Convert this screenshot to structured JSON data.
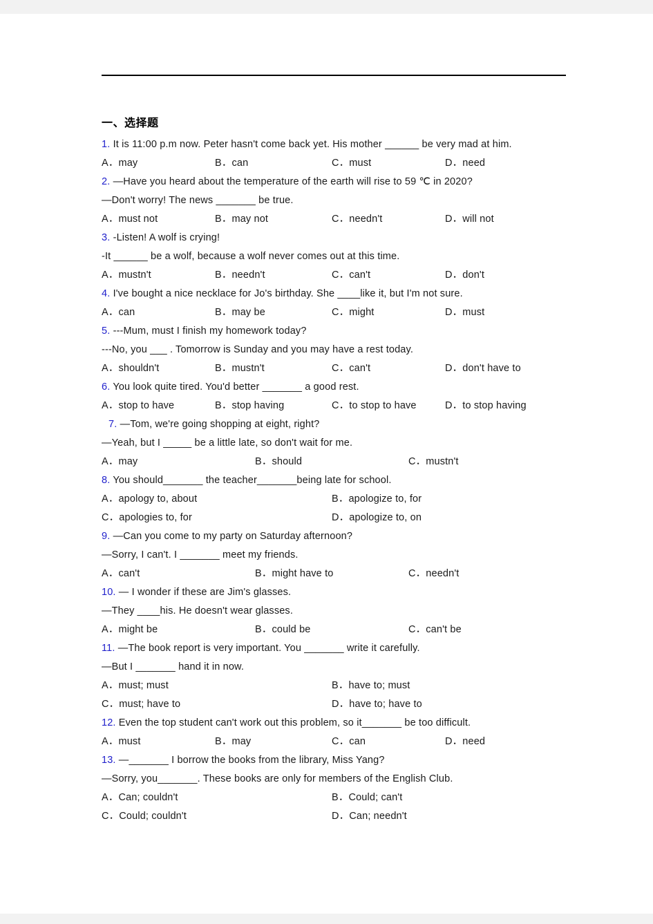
{
  "page": {
    "section_title": "一、选择题"
  },
  "questions": [
    {
      "lines": [
        {
          "num": "1.",
          "text": " It is 11:00 p.m now. Peter hasn't come back yet. His mother ______ be very mad at him."
        }
      ],
      "options_layout": "c4",
      "options": [
        "A．may",
        "B．can",
        "C．must",
        "D．need"
      ]
    },
    {
      "lines": [
        {
          "num": "2.",
          "text": " —Have you heard about the temperature of the earth will rise to 59 ℃ in 2020?"
        },
        {
          "num": "",
          "text": "—Don't worry! The news _______ be true."
        }
      ],
      "options_layout": "c4",
      "options": [
        "A．must not",
        "B．may not",
        "C．needn't",
        "D．will not"
      ]
    },
    {
      "lines": [
        {
          "num": "3.",
          "text": " -Listen! A wolf is crying!"
        },
        {
          "num": "",
          "text": "-It ______ be a wolf, because a wolf never comes out at this time."
        }
      ],
      "options_layout": "c4",
      "options": [
        "A．mustn't",
        "B．needn't",
        "C．can't",
        "D．don't"
      ]
    },
    {
      "lines": [
        {
          "num": "4.",
          "text": " I've bought a nice necklace for Jo's birthday. She ____like it, but I'm not sure."
        }
      ],
      "options_layout": "c4",
      "options": [
        "A．can",
        "B．may be",
        "C．might",
        "D．must"
      ]
    },
    {
      "lines": [
        {
          "num": "5.",
          "text": " ---Mum, must I finish my homework today?"
        },
        {
          "num": "",
          "text": "---No, you ___ . Tomorrow is Sunday and you may have a rest today."
        }
      ],
      "options_layout": "c4",
      "options": [
        "A．shouldn't",
        "B．mustn't",
        "C．can't",
        "D．don't have to"
      ]
    },
    {
      "lines": [
        {
          "num": "6.",
          "text": " You look quite tired. You'd better _______ a good rest."
        }
      ],
      "options_layout": "c4",
      "options": [
        "A．stop to have",
        "B．stop having",
        "C．to stop to have",
        "D．to stop having"
      ]
    },
    {
      "lines": [
        {
          "num": "7.",
          "text": " —Tom, we're going shopping at eight, right?",
          "indent": true
        },
        {
          "num": "",
          "text": "—Yeah, but I _____ be a little late, so don't wait for me."
        }
      ],
      "options_layout": "c3",
      "options": [
        "A．may",
        "B．should",
        "C．mustn't"
      ]
    },
    {
      "lines": [
        {
          "num": "8.",
          "text": " You should_______ the teacher_______being late for school."
        }
      ],
      "options_layout": "c2",
      "options": [
        "A．apology to, about",
        "B．apologize to, for",
        "C．apologies to, for",
        "D．apologize to, on"
      ]
    },
    {
      "lines": [
        {
          "num": "9.",
          "text": " —Can you come to my party on Saturday afternoon?"
        },
        {
          "num": "",
          "text": "—Sorry, I can't. I _______ meet my friends."
        }
      ],
      "options_layout": "c3",
      "options": [
        "A．can't",
        "B．might have to",
        "C．needn't"
      ]
    },
    {
      "lines": [
        {
          "num": "10.",
          "text": " — I wonder if these are Jim's glasses."
        },
        {
          "num": "",
          "text": "—They ____his. He doesn't wear glasses."
        }
      ],
      "options_layout": "c3",
      "options": [
        "A．might be",
        "B．could be",
        "C．can't be"
      ]
    },
    {
      "lines": [
        {
          "num": "11.",
          "text": " —The book report is very important. You _______ write it carefully."
        },
        {
          "num": "",
          "text": "—But I _______ hand it in now."
        }
      ],
      "options_layout": "c2",
      "options": [
        "A．must; must",
        "B．have to; must",
        "C．must; have to",
        "D．have to; have to"
      ]
    },
    {
      "lines": [
        {
          "num": "12.",
          "text": " Even the top student can't work out this problem, so it_______ be too difficult."
        }
      ],
      "options_layout": "c4",
      "options": [
        "A．must",
        "B．may",
        "C．can",
        "D．need"
      ]
    },
    {
      "lines": [
        {
          "num": "13.",
          "text": " —_______ I borrow the books from the library, Miss Yang?"
        },
        {
          "num": "",
          "text": "—Sorry, you_______. These books are only for members of the English Club."
        }
      ],
      "options_layout": "c2",
      "options": [
        "A．Can; couldn't",
        "B．Could; can't",
        "C．Could; couldn't",
        "D．Can; needn't"
      ]
    }
  ]
}
